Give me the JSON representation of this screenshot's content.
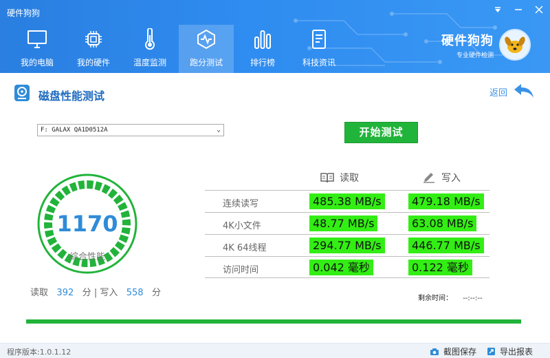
{
  "app": {
    "title": "硬件狗狗"
  },
  "nav": {
    "items": [
      {
        "label": "我的电脑",
        "icon": "monitor-icon"
      },
      {
        "label": "我的硬件",
        "icon": "chip-icon"
      },
      {
        "label": "温度监测",
        "icon": "thermometer-icon"
      },
      {
        "label": "跑分测试",
        "icon": "benchmark-icon",
        "active": true
      },
      {
        "label": "排行榜",
        "icon": "bar-chart-icon"
      },
      {
        "label": "科技资讯",
        "icon": "document-icon"
      }
    ]
  },
  "brand": {
    "name": "硬件狗狗",
    "slogan": "专业硬件检测"
  },
  "section": {
    "title": "磁盘性能测试",
    "back_label": "返回"
  },
  "controls": {
    "drive": "F: GALAX QA1D0512A",
    "start_label": "开始测试"
  },
  "gauge": {
    "score": "1170",
    "label": "综合性能",
    "fill": 1.0
  },
  "scores": {
    "read_label": "读取",
    "read_value": "392",
    "unit": "分",
    "separator": "|",
    "write_label": "写入",
    "write_value": "558"
  },
  "table": {
    "read_header": "读取",
    "write_header": "写入",
    "rows": [
      {
        "label": "连续读写",
        "read": "485.38 MB/s",
        "write": "479.18 MB/s"
      },
      {
        "label": "4K小文件",
        "read": "48.77 MB/s",
        "write": "63.08 MB/s"
      },
      {
        "label": "4K 64线程",
        "read": "294.77 MB/s",
        "write": "446.77 MB/s"
      },
      {
        "label": "访问时间",
        "read": "0.042 毫秒",
        "write": "0.122 毫秒"
      }
    ]
  },
  "remaining": {
    "label": "剩余时间：",
    "value": "--:--:--"
  },
  "progress": {
    "value": 1.0
  },
  "footer": {
    "version": "程序版本:1.0.1.12",
    "screenshot_label": "截图保存",
    "export_label": "导出报表"
  },
  "colors": {
    "header": "#2f8cf0",
    "accent_green": "#21b43a",
    "value_highlight": "#33ee14",
    "score_blue": "#2f8cd8"
  }
}
